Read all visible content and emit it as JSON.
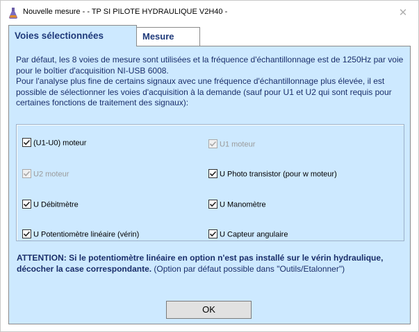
{
  "window": {
    "title": "Nouvelle mesure -  - TP SI PILOTE HYDRAULIQUE V2H40 -",
    "close_glyph": "✕",
    "app_icon": "flask-icon"
  },
  "tabs": [
    {
      "label": "Voies sélectionnées",
      "active": true
    },
    {
      "label": "Mesure",
      "active": false
    }
  ],
  "intro": {
    "line1": "Par défaut, les 8 voies de mesure sont utilisées et la fréquence d'échantillonnage est de 1250Hz par voie pour le boîtier d'acquisition NI-USB 6008.",
    "line2": "Pour l'analyse plus fine de certains signaux avec une fréquence d'échantillonnage plus élevée, il est possible de sélectionner les voies d'acquisition à la demande (sauf pour U1 et U2 qui sont requis pour certaines fonctions de traitement des signaux):"
  },
  "channels": [
    {
      "label": "(U1-U0) moteur",
      "checked": true,
      "enabled": true
    },
    {
      "label": "U1 moteur",
      "checked": true,
      "enabled": false
    },
    {
      "label": "U2 moteur",
      "checked": true,
      "enabled": false
    },
    {
      "label": "U Photo transistor (pour w moteur)",
      "checked": true,
      "enabled": true
    },
    {
      "label": "U Débitmètre",
      "checked": true,
      "enabled": true
    },
    {
      "label": "U Manomètre",
      "checked": true,
      "enabled": true
    },
    {
      "label": "U Potentiomètre linéaire (vérin)",
      "checked": true,
      "enabled": true
    },
    {
      "label": "U Capteur angulaire",
      "checked": true,
      "enabled": true
    }
  ],
  "warning": {
    "bold": "ATTENTION: Si le potentiomètre linéaire en option n'est pas installé sur le vérin hydraulique, décocher la case correspondante.",
    "normal": " (Option par défaut possible dans \"Outils/Etalonner\")"
  },
  "buttons": {
    "ok": "OK"
  },
  "colors": {
    "panel_bg": "#cde9ff",
    "text_blue": "#1a2e6a",
    "tab_text": "#1f3a7a"
  }
}
